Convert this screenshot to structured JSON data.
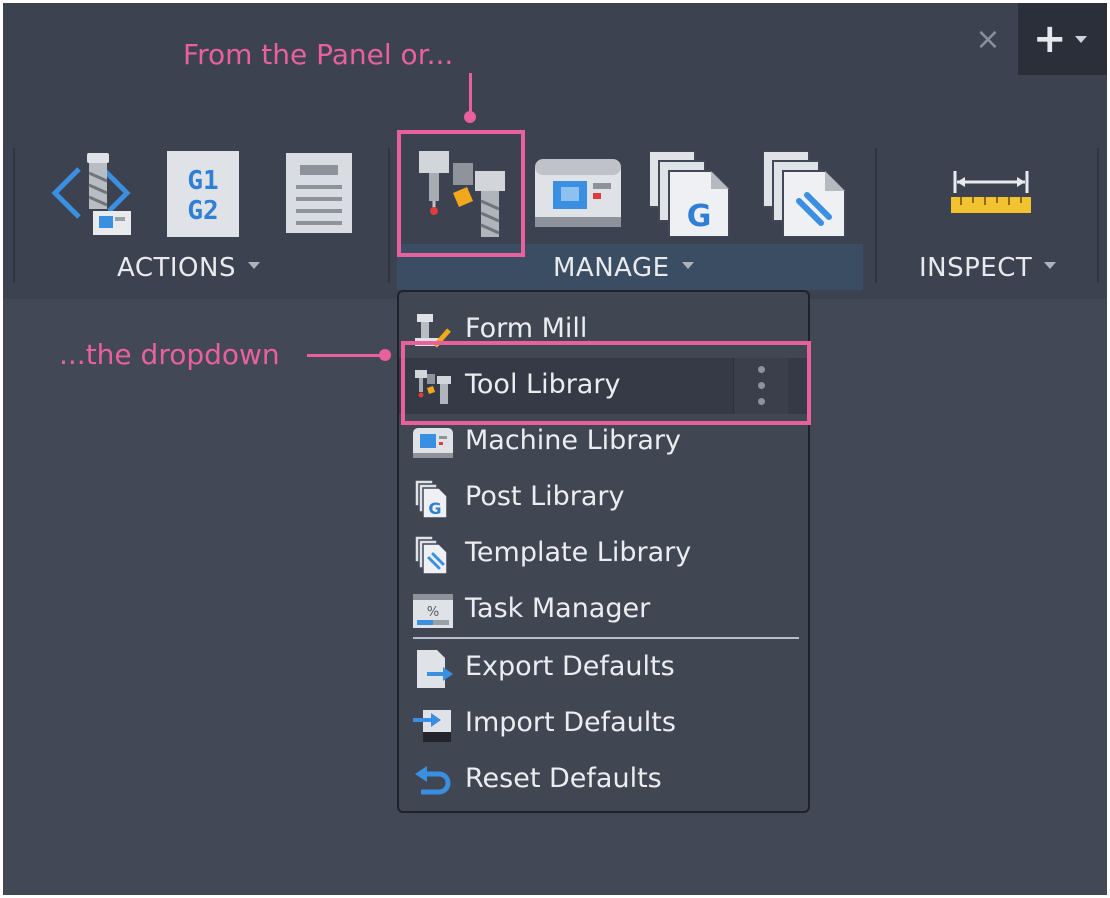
{
  "window": {
    "close_label": "×",
    "new_tab_label": "+"
  },
  "ribbon": {
    "groups": [
      {
        "id": "actions",
        "label": "ACTIONS",
        "tools": [
          {
            "name": "simulate",
            "icon": "simulate-icon"
          },
          {
            "name": "post-process",
            "icon": "g1-g2-icon",
            "text_top": "G1",
            "text_bottom": "G2"
          },
          {
            "name": "setup-sheet",
            "icon": "setup-sheet-icon"
          }
        ]
      },
      {
        "id": "manage",
        "label": "MANAGE",
        "tools": [
          {
            "name": "tool-library",
            "icon": "tool-library-icon"
          },
          {
            "name": "machine-library",
            "icon": "machine-library-icon"
          },
          {
            "name": "post-library",
            "icon": "post-library-icon",
            "text": "G"
          },
          {
            "name": "template-library",
            "icon": "template-library-icon"
          }
        ]
      },
      {
        "id": "inspect",
        "label": "INSPECT",
        "tools": [
          {
            "name": "measure",
            "icon": "ruler-icon"
          }
        ]
      }
    ]
  },
  "annotations": {
    "panel": "From the Panel or...",
    "dropdown": "...the dropdown"
  },
  "manage_menu": {
    "items": [
      {
        "label": "Form Mill",
        "icon": "form-mill-icon"
      },
      {
        "label": "Tool Library",
        "icon": "tool-library-icon",
        "highlighted": true
      },
      {
        "label": "Machine Library",
        "icon": "machine-library-icon"
      },
      {
        "label": "Post Library",
        "icon": "post-library-icon"
      },
      {
        "label": "Template Library",
        "icon": "template-library-icon"
      },
      {
        "label": "Task Manager",
        "icon": "task-manager-icon"
      },
      {
        "label": "Export Defaults",
        "icon": "export-icon"
      },
      {
        "label": "Import Defaults",
        "icon": "import-icon"
      },
      {
        "label": "Reset Defaults",
        "icon": "reset-icon"
      }
    ]
  },
  "colors": {
    "annotation": "#e8609c",
    "background": "#434857",
    "toolbar": "#3d4250",
    "manage_bar": "#3a4d62",
    "accent_blue": "#3b8fe0"
  }
}
